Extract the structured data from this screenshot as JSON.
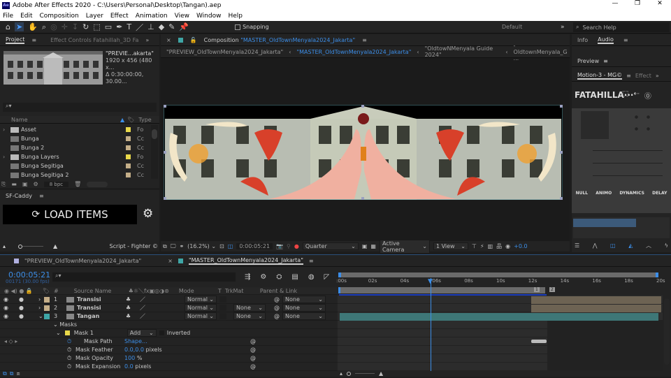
{
  "app": {
    "title": "Adobe After Effects 2020 - C:\\Users\\Personal\\Desktop\\Tangan).aep",
    "logo": "Ae"
  },
  "menu": [
    "File",
    "Edit",
    "Composition",
    "Layer",
    "Effect",
    "Animation",
    "View",
    "Window",
    "Help"
  ],
  "toolbar": {
    "snapping": "Snapping",
    "workspace": "Default",
    "search_placeholder": "Search Help"
  },
  "project": {
    "tab": "Project",
    "effect_controls": "Effect Controls Fatahillah_3D Fa",
    "comp_name": "\"PREVIE...akarta\"",
    "dims": "1920 x 456  (480 x...",
    "duration": "Δ 0:30:00:00, 30.00...",
    "col_name": "Name",
    "col_type": "Type",
    "bpc": "8 bpc",
    "items": [
      {
        "name": "Asset",
        "type": "Fo",
        "folder": true,
        "color": "#e8d84a"
      },
      {
        "name": "Bunga",
        "type": "Cc",
        "folder": false,
        "color": "#c4ae88"
      },
      {
        "name": "Bunga 2",
        "type": "Cc",
        "folder": false,
        "color": "#c4ae88"
      },
      {
        "name": "Bunga Layers",
        "type": "Fo",
        "folder": true,
        "color": "#e8d84a"
      },
      {
        "name": "Bunga Segitiga",
        "type": "Cc",
        "folder": false,
        "color": "#c4ae88"
      },
      {
        "name": "Bunga Segitiga 2",
        "type": "Cc",
        "folder": false,
        "color": "#c4ae88"
      }
    ]
  },
  "caddy": {
    "tab": "SF-Caddy",
    "load": "LOAD ITEMS",
    "credit": "Script - Fighter ©"
  },
  "comp": {
    "tab_prefix": "Composition",
    "tab_name": "\"MASTER_OldTownMenyala2024_Jakarta\"",
    "crumbs": [
      "\"PREVIEW_OldTownMenyala2024_Jakarta\"",
      "\"MASTER_OldTownMenyala2024_Jakarta\"",
      "\"OldtowNMenyala Guide 2024\"",
      "- OldtownMenyala_G ..."
    ],
    "zoom": "(16.2%)",
    "time": "0:00:05:21",
    "resolution": "Quarter",
    "camera": "Active Camera",
    "views": "1 View",
    "exposure": "+0.0"
  },
  "right": {
    "info": "Info",
    "audio": "Audio",
    "preview": "Preview",
    "motion": "Motion-3 - MG©",
    "effects": "Effect",
    "comp_label": "FATAHILLA···",
    "buttons": [
      "NULL",
      "ANIMO",
      "DYNAMICS",
      "DELAY"
    ]
  },
  "timeline": {
    "tabs": [
      "\"PREVIEW_OldTownMenyala2024_Jakarta\"",
      "\"MASTER_OldTownMenyala2024_Jakarta\""
    ],
    "timecode": "0:00:05:21",
    "frames": "00171 (30.00 fps)",
    "headers": {
      "num": "#",
      "source": "Source Name",
      "mode": "Mode",
      "t": "T",
      "trkmat": "TrkMat",
      "parent": "Parent & Link"
    },
    "layers": [
      {
        "num": "1",
        "name": "Transisi",
        "mode": "Normal",
        "trkmat": "",
        "parent": "None",
        "color": "#c4ae88"
      },
      {
        "num": "2",
        "name": "Transisi",
        "mode": "Normal",
        "trkmat": "None",
        "parent": "None",
        "color": "#c4ae88"
      },
      {
        "num": "3",
        "name": "Tangan",
        "mode": "Normal",
        "trkmat": "None",
        "parent": "None",
        "color": "#3fa6a6"
      }
    ],
    "masks": "Masks",
    "mask1": "Mask 1",
    "mask_mode": "Add",
    "inverted": "Inverted",
    "props": [
      {
        "name": "Mask Path",
        "value": "Shape...",
        "unit": ""
      },
      {
        "name": "Mask Feather",
        "value": "0.0,0.0",
        "unit": "pixels"
      },
      {
        "name": "Mask Opacity",
        "value": "100",
        "unit": "%"
      },
      {
        "name": "Mask Expansion",
        "value": "0.0",
        "unit": "pixels"
      }
    ],
    "ruler": [
      ":00s",
      "02s",
      "04s",
      "06s",
      "08s",
      "10s",
      "12s",
      "14s",
      "16s",
      "18s",
      "20s"
    ],
    "markers": [
      "1",
      "2"
    ],
    "current_time_s": 5.7,
    "work_area_end_s": 13
  }
}
